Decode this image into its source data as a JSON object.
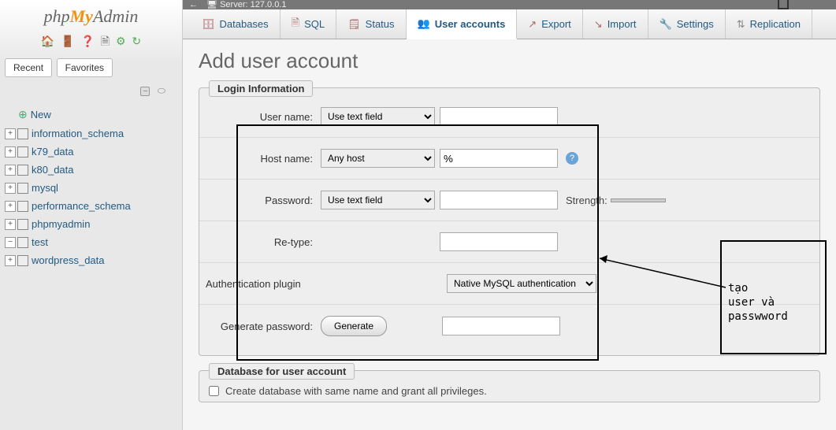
{
  "topbar": {
    "server_label": "Server: 127.0.0.1"
  },
  "sidebar": {
    "tabs": {
      "recent": "Recent",
      "favorites": "Favorites"
    },
    "new_label": "New",
    "items": [
      "information_schema",
      "k79_data",
      "k80_data",
      "mysql",
      "performance_schema",
      "phpmyadmin",
      "test",
      "wordpress_data"
    ]
  },
  "nav": {
    "databases": "Databases",
    "sql": "SQL",
    "status": "Status",
    "user_accounts": "User accounts",
    "export": "Export",
    "import": "Import",
    "settings": "Settings",
    "replication": "Replication"
  },
  "page": {
    "title": "Add user account"
  },
  "login_info": {
    "legend": "Login Information",
    "username_label": "User name:",
    "username_select": "Use text field",
    "hostname_label": "Host name:",
    "hostname_select": "Any host",
    "hostname_value": "%",
    "password_label": "Password:",
    "password_select": "Use text field",
    "strength_label": "Strength:",
    "retype_label": "Re-type:",
    "auth_label": "Authentication plugin",
    "auth_select": "Native MySQL authentication",
    "gen_label": "Generate password:",
    "gen_button": "Generate"
  },
  "db_section": {
    "legend": "Database for user account",
    "checkbox_label": "Create database with same name and grant all privileges."
  },
  "annotation": {
    "text": "tạo\nuser và\npasswword"
  }
}
